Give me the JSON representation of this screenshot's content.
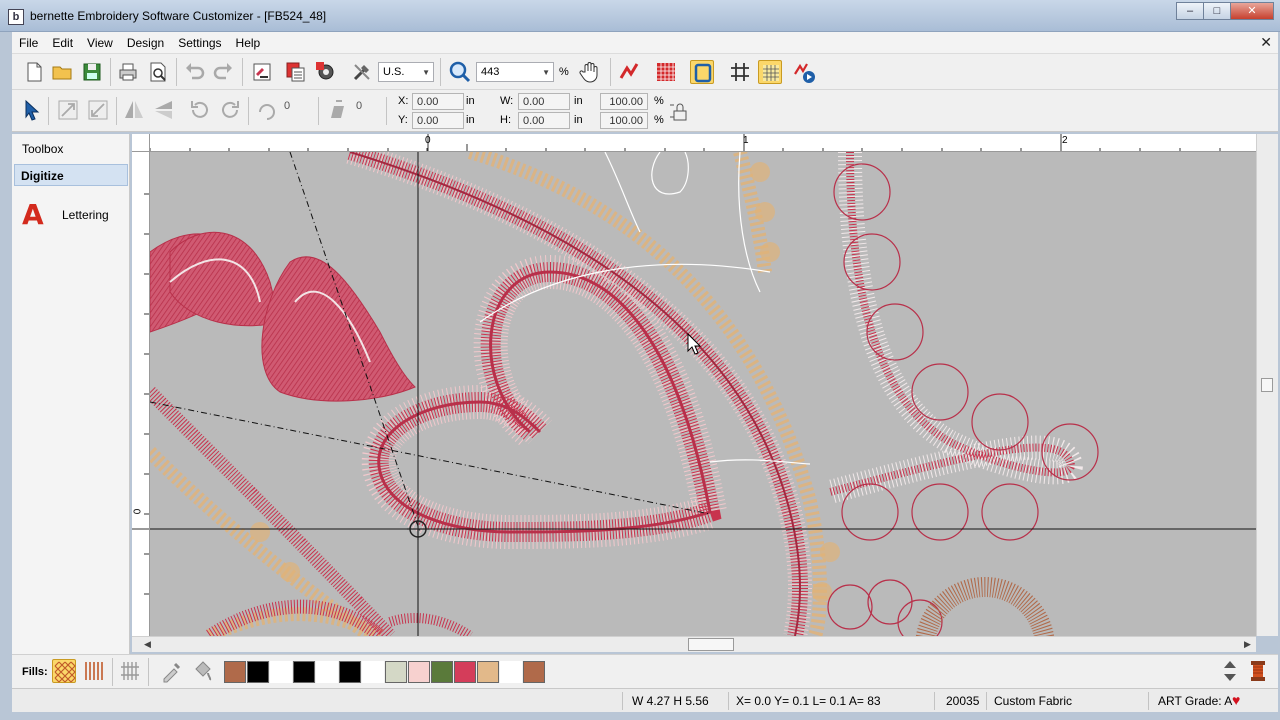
{
  "window": {
    "title": "bernette Embroidery Software Customizer - [FB524_48]",
    "app_icon_letter": "b",
    "minimize": "–",
    "maximize": "□",
    "close": "✕"
  },
  "menu": {
    "items": [
      "File",
      "Edit",
      "View",
      "Design",
      "Settings",
      "Help"
    ],
    "doc_close": "✕"
  },
  "toolbar": {
    "units": "U.S.",
    "zoom": "443",
    "zoom_unit": "%"
  },
  "position_bar": {
    "rotate_value": "0",
    "skew_value": "0",
    "x_label": "X:",
    "x_value": "0.00",
    "y_label": "Y:",
    "y_value": "0.00",
    "w_label": "W:",
    "w_value": "0.00",
    "h_label": "H:",
    "h_value": "0.00",
    "unit": "in",
    "scale_w": "100.00",
    "scale_h": "100.00",
    "pct": "%"
  },
  "toolbox": {
    "title": "Toolbox",
    "section": "Digitize",
    "lettering_icon": "A",
    "lettering_label": "Lettering"
  },
  "ruler": {
    "top_labels": [
      "0",
      "1",
      "2"
    ],
    "left_label": "0"
  },
  "fills": {
    "label": "Fills:",
    "swatches": [
      "#b06a4a",
      "#000000",
      "#ffffff",
      "#000000",
      "#ffffff",
      "#000000",
      "#ffffff",
      "#d4d8c6",
      "#f7d1cf",
      "#5a7a3a",
      "#d43d5a",
      "#e2b98a",
      "#ffffff",
      "#b06a4a"
    ]
  },
  "status": {
    "size": "W 4.27 H 5.56",
    "coords": "X=  0.0 Y=  0.1 L=  0.1 A= 83",
    "stitches": "20035",
    "fabric": "Custom Fabric",
    "art_grade": "ART Grade: A"
  },
  "colors": {
    "stitch_red": "#c8344e",
    "stitch_pink": "#f2c8cc",
    "stitch_tan": "#e0b37a",
    "canvas_bg": "#bababa",
    "accent_red": "#d32a1d"
  }
}
